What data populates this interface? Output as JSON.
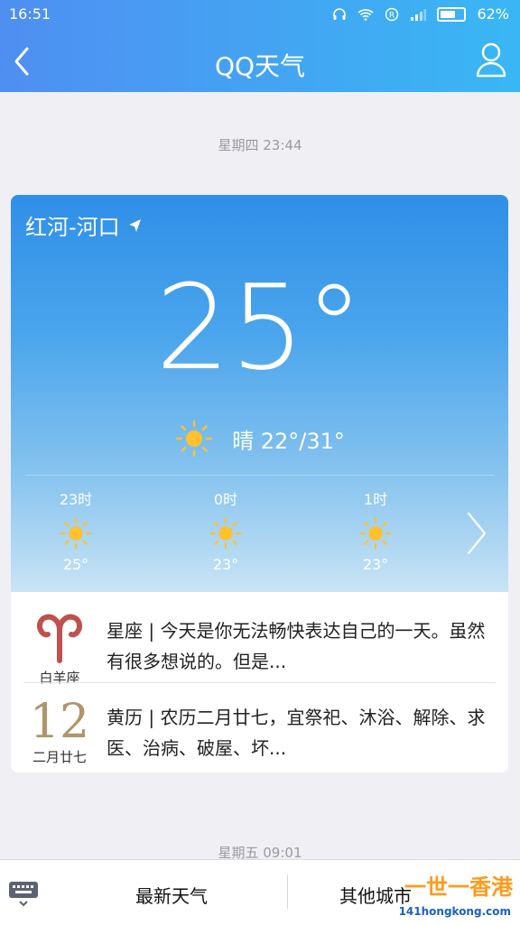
{
  "status_bar": {
    "time": "16:51",
    "battery": "62%"
  },
  "header": {
    "title": "QQ天气"
  },
  "timestamps": {
    "first": "星期四 23:44",
    "second": "星期五 09:01"
  },
  "weather": {
    "location": "红河-河口",
    "current_temp": "25°",
    "condition": "晴 22°/31°",
    "hourly": [
      {
        "time": "23时",
        "temp": "25°",
        "icon": "sun-icon"
      },
      {
        "time": "0时",
        "temp": "23°",
        "icon": "sun-icon"
      },
      {
        "time": "1时",
        "temp": "23°",
        "icon": "sun-icon"
      }
    ]
  },
  "info": {
    "zodiac": {
      "label": "白羊座",
      "text": "星座 | 今天是你无法畅快表达自己的一天。虽然有很多想说的。但是..."
    },
    "almanac": {
      "day": "12",
      "label": "二月廿七",
      "text": "黄历 | 农历二月廿七，宜祭祀、沐浴、解除、求医、治病、破屋、坏..."
    }
  },
  "bottom_bar": {
    "tab_latest": "最新天气",
    "tab_other": "其他城市",
    "watermark": "一世一香港",
    "watermark_url": "141hongkong.com"
  },
  "colors": {
    "accent": "#4f8ff1",
    "sun": "#ffc12e",
    "calendar": "#b0946a",
    "aries": "#c0504d"
  }
}
